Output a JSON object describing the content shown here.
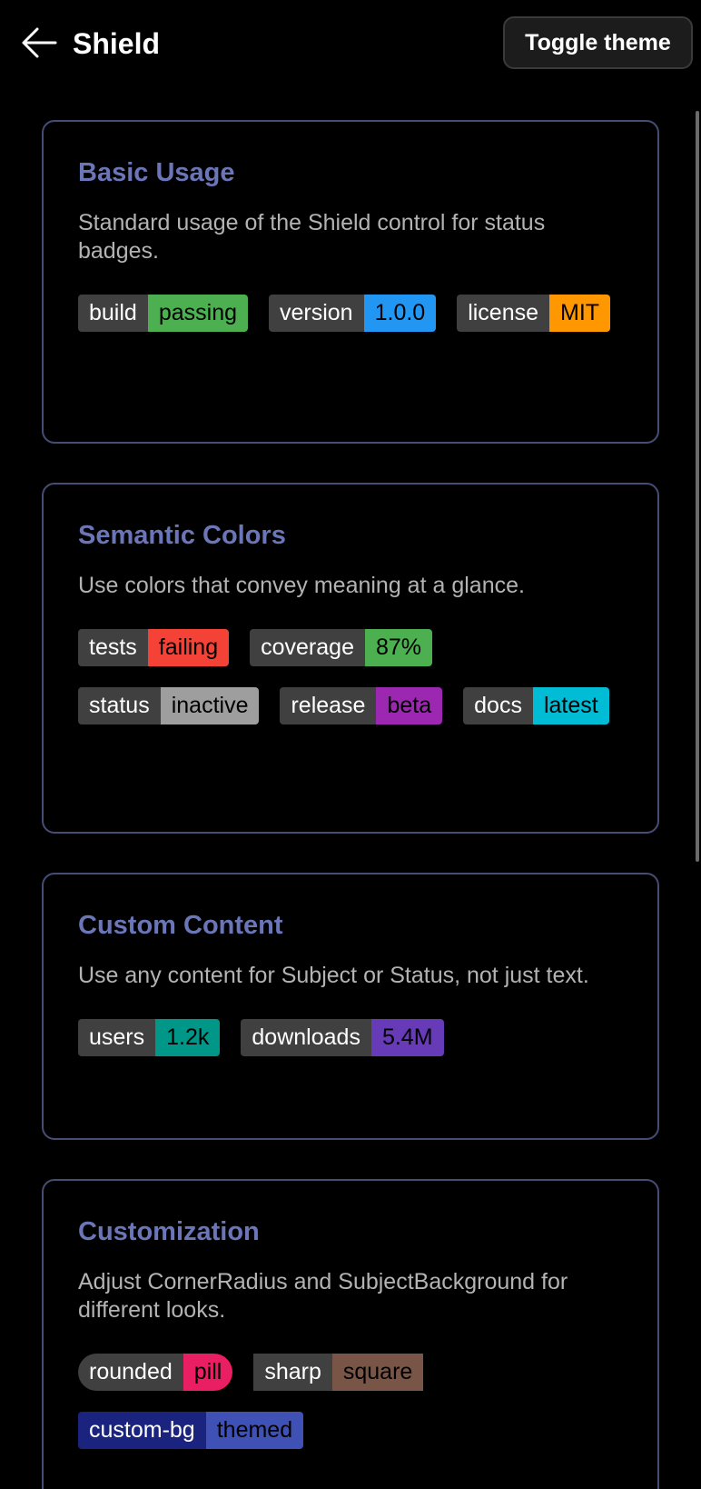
{
  "app": {
    "title": "Shield",
    "toggle_label": "Toggle theme"
  },
  "sections": [
    {
      "title": "Basic Usage",
      "description": "Standard usage of the Shield control for status badges.",
      "badges": [
        {
          "subject": "build",
          "status": "passing",
          "color": "#4caf50"
        },
        {
          "subject": "version",
          "status": "1.0.0",
          "color": "#2196f3"
        },
        {
          "subject": "license",
          "status": "MIT",
          "color": "#ff9800"
        }
      ]
    },
    {
      "title": "Semantic Colors",
      "description": "Use colors that convey meaning at a glance.",
      "badges": [
        {
          "subject": "tests",
          "status": "failing",
          "color": "#f44336"
        },
        {
          "subject": "coverage",
          "status": "87%",
          "color": "#4caf50"
        },
        {
          "subject": "status",
          "status": "inactive",
          "color": "#9e9e9e"
        },
        {
          "subject": "release",
          "status": "beta",
          "color": "#9c27b0"
        },
        {
          "subject": "docs",
          "status": "latest",
          "color": "#00bcd4"
        }
      ]
    },
    {
      "title": "Custom Content",
      "description": "Use any content for Subject or Status, not just text.",
      "badges": [
        {
          "subject": "users",
          "status": "1.2k",
          "color": "#009688"
        },
        {
          "subject": "downloads",
          "status": "5.4M",
          "color": "#673ab7"
        }
      ]
    },
    {
      "title": "Customization",
      "description": "Adjust CornerRadius and SubjectBackground for different looks.",
      "badges": [
        {
          "subject": "rounded",
          "status": "pill",
          "color": "#e91e63",
          "shape": "pill"
        },
        {
          "subject": "sharp",
          "status": "square",
          "color": "#795548",
          "shape": "sharp"
        },
        {
          "subject": "custom-bg",
          "status": "themed",
          "color": "#3f51b5",
          "subject_bg": "#1a237e"
        }
      ]
    }
  ]
}
